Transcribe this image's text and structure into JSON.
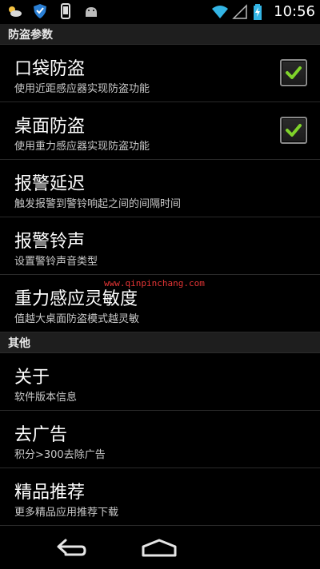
{
  "status_bar": {
    "left_icons": [
      "weather-icon",
      "shield-icon",
      "phone-icon",
      "android-icon"
    ],
    "time": "10:56"
  },
  "sections": [
    {
      "title": "防盗参数",
      "items": [
        {
          "title": "口袋防盗",
          "subtitle": "使用近距感应器实现防盗功能",
          "checked": true
        },
        {
          "title": "桌面防盗",
          "subtitle": "使用重力感应器实现防盗功能",
          "checked": true
        },
        {
          "title": "报警延迟",
          "subtitle": "触发报警到警铃响起之间的间隔时间"
        },
        {
          "title": "报警铃声",
          "subtitle": "设置警铃声音类型"
        },
        {
          "title": "重力感应灵敏度",
          "subtitle": "值越大桌面防盗模式越灵敏"
        }
      ]
    },
    {
      "title": "其他",
      "items": [
        {
          "title": "关于",
          "subtitle": "软件版本信息"
        },
        {
          "title": "去广告",
          "subtitle": "积分>300去除广告"
        },
        {
          "title": "精品推荐",
          "subtitle": "更多精品应用推荐下载"
        }
      ]
    }
  ],
  "watermark": "www.qinpinchang.com",
  "colors": {
    "background": "#000000",
    "section_header_bg": "#1e1e1e",
    "check_green": "#7fd32a",
    "watermark_red": "#ff3b3b"
  }
}
